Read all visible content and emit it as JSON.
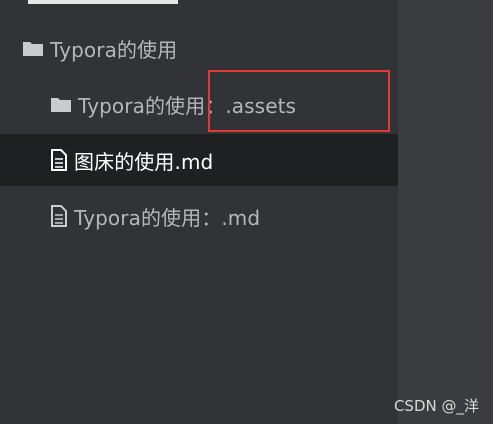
{
  "file_tree": {
    "items": [
      {
        "type": "folder",
        "icon": "folder-icon",
        "label": "Typora的使用"
      },
      {
        "type": "folder",
        "icon": "folder-icon",
        "label": "Typora的使用：.assets"
      },
      {
        "type": "file",
        "icon": "document-icon",
        "label": "图床的使用.md",
        "active": true
      },
      {
        "type": "file",
        "icon": "document-icon",
        "label": "Typora的使用：.md"
      }
    ]
  },
  "annotation": {
    "highlight_color": "#e53935"
  },
  "watermark": {
    "text": "CSDN @_洋"
  },
  "colors": {
    "sidebar_bg": "#313336",
    "active_row_bg": "#1f2022",
    "text": "#b5b7ba",
    "active_text": "#ffffff"
  }
}
